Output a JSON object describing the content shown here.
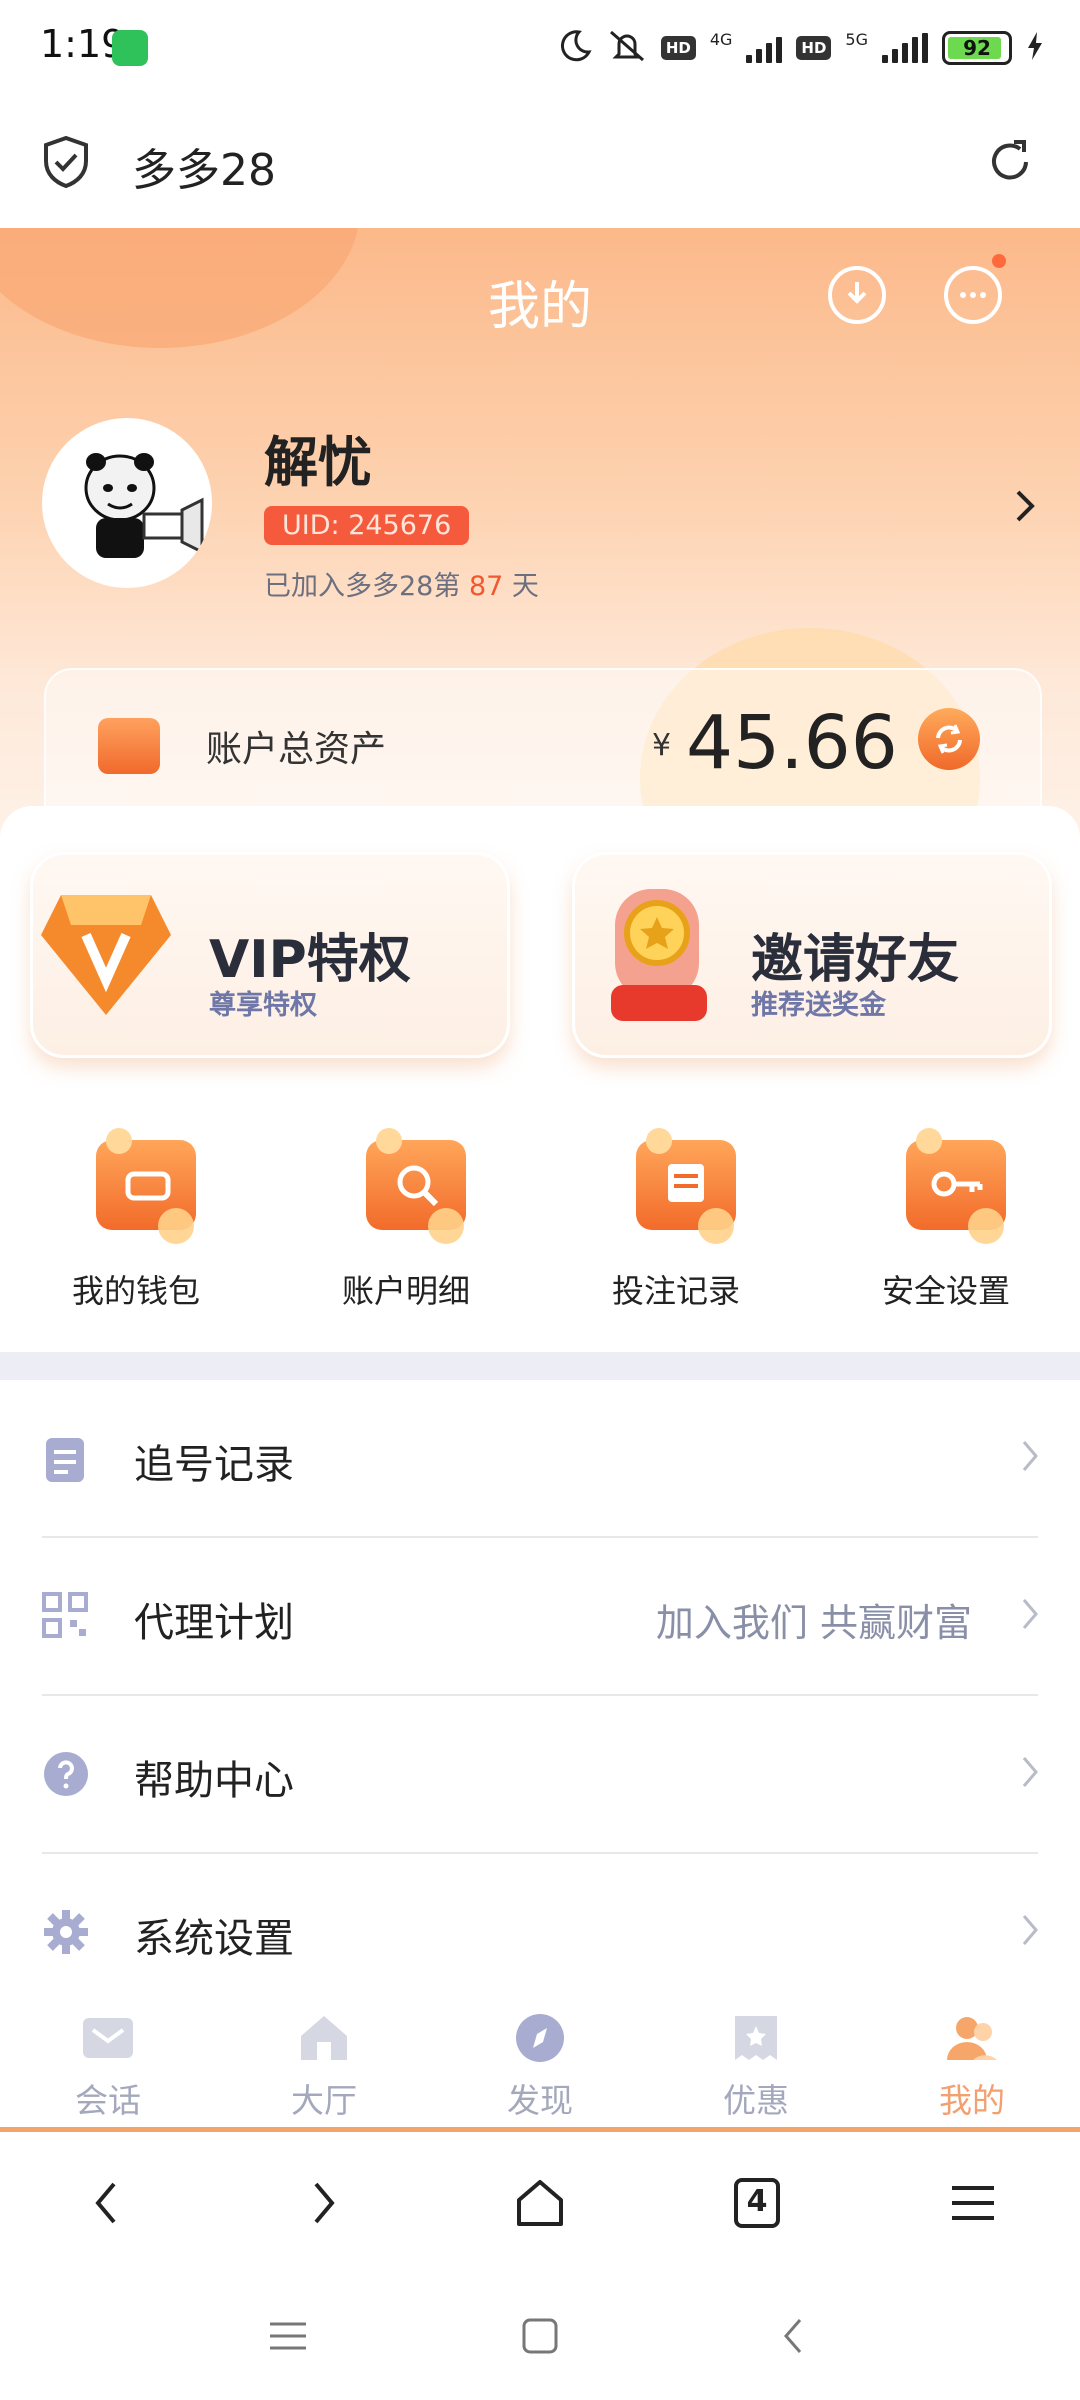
{
  "status_bar": {
    "time": "1:19",
    "net1": "4G",
    "net2": "5G",
    "hd": "HD",
    "battery": "92",
    "battery_level": 0.92
  },
  "browser": {
    "site_title": "多多28"
  },
  "hero": {
    "title": "我的",
    "user_name": "解忧",
    "uid": "UID: 245676",
    "joined_prefix": "已加入多多28第",
    "joined_days": "87",
    "joined_suffix": "天"
  },
  "assets": {
    "label": "账户总资产",
    "currency": "¥",
    "value": "45.66"
  },
  "promos": [
    {
      "title": "VIP特权",
      "subtitle": "尊享特权"
    },
    {
      "title": "邀请好友",
      "subtitle": "推荐送奖金"
    }
  ],
  "quick_actions": [
    {
      "label": "我的钱包",
      "icon": "wallet-icon"
    },
    {
      "label": "账户明细",
      "icon": "magnifier-icon"
    },
    {
      "label": "投注记录",
      "icon": "calendar-icon"
    },
    {
      "label": "安全设置",
      "icon": "key-icon"
    }
  ],
  "menu": [
    {
      "label": "追号记录",
      "extra": "",
      "icon": "clipboard-icon"
    },
    {
      "label": "代理计划",
      "extra": "加入我们 共赢财富",
      "icon": "qr-code-icon"
    },
    {
      "label": "帮助中心",
      "extra": "",
      "icon": "help-icon"
    },
    {
      "label": "系统设置",
      "extra": "",
      "icon": "gear-icon"
    }
  ],
  "tabs": [
    {
      "label": "会话",
      "icon": "mail-icon",
      "active": false
    },
    {
      "label": "大厅",
      "icon": "house-icon",
      "active": false
    },
    {
      "label": "发现",
      "icon": "compass-icon",
      "active": false
    },
    {
      "label": "优惠",
      "icon": "coupon-icon",
      "active": false
    },
    {
      "label": "我的",
      "icon": "user-icon",
      "active": true
    }
  ],
  "browser_nav": {
    "tab_count": "4"
  },
  "colors": {
    "accent": "#f0692a",
    "uid_badge": "#f55a3d",
    "tab_active": "#f3a070",
    "muted": "#8a8fa8"
  }
}
